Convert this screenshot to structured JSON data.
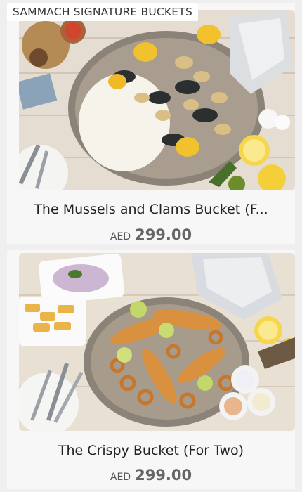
{
  "section": {
    "title": "SAMMACH SIGNATURE BUCKETS"
  },
  "products": [
    {
      "name": "The Mussels and Clams Bucket (F...",
      "currency": "AED",
      "price": "299.00"
    },
    {
      "name": "The Crispy Bucket (For Two)",
      "currency": "AED",
      "price": "299.00"
    }
  ]
}
